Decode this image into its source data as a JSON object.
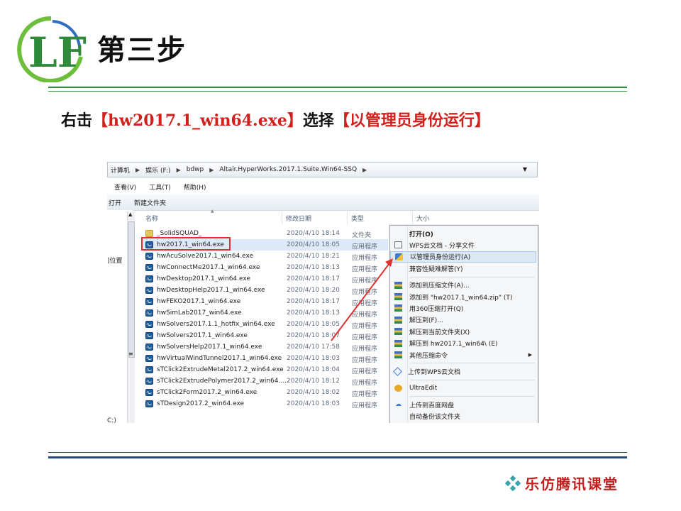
{
  "slide": {
    "title": "第三步",
    "logo_text": "LF",
    "instruction": {
      "prefix": "右击",
      "target": "【hw2017.1_win64.exe】",
      "middle": "选择",
      "action": "【以管理员身份运行】"
    },
    "brand": "乐仿腾讯课堂",
    "colors": {
      "accent_green": "#2f8a3a",
      "accent_red": "#d0211d",
      "footer_blue": "#2a4a85"
    }
  },
  "explorer": {
    "address": [
      "计算机",
      "娱乐 (F:)",
      "bdwp",
      "Altair.HyperWorks.2017.1.Suite.Win64-SSQ"
    ],
    "menu": [
      "查看(V)",
      "工具(T)",
      "帮助(H)"
    ],
    "toolbar": [
      "打开",
      "新建文件夹"
    ],
    "left_pane": {
      "location": "]位置",
      "drive": "C:)"
    },
    "columns": {
      "name": "名称",
      "date": "修改日期",
      "type": "类型",
      "size": "大小"
    },
    "files": [
      {
        "name": "_SolidSQUAD_",
        "date": "2020/4/10 18:14",
        "type": "文件夹",
        "icon": "folder-icon"
      },
      {
        "name": "hw2017.1_win64.exe",
        "date": "2020/4/10 18:05",
        "type": "应用程序",
        "icon": "exe-icon",
        "selected": true
      },
      {
        "name": "hwAcuSolve2017.1_win64.exe",
        "date": "2020/4/10 18:21",
        "type": "应用程序",
        "icon": "exe-icon"
      },
      {
        "name": "hwConnectMe2017.1_win64.exe",
        "date": "2020/4/10 18:13",
        "type": "应用程序",
        "icon": "exe-icon"
      },
      {
        "name": "hwDesktop2017.1_win64.exe",
        "date": "2020/4/10 18:17",
        "type": "应用程序",
        "icon": "exe-icon"
      },
      {
        "name": "hwDesktopHelp2017.1_win64.exe",
        "date": "2020/4/10 18:20",
        "type": "应用程序",
        "icon": "exe-icon"
      },
      {
        "name": "hwFEKO2017.1_win64.exe",
        "date": "2020/4/10 18:17",
        "type": "应用程序",
        "icon": "exe-icon"
      },
      {
        "name": "hwSimLab2017_win64.exe",
        "date": "2020/4/10 18:13",
        "type": "应用程序",
        "icon": "exe-icon"
      },
      {
        "name": "hwSolvers2017.1.1_hotfix_win64.exe",
        "date": "2020/4/10 18:05",
        "type": "应用程序",
        "icon": "exe-icon"
      },
      {
        "name": "hwSolvers2017.1_win64.exe",
        "date": "2020/4/10 18:07",
        "type": "应用程序",
        "icon": "exe-icon"
      },
      {
        "name": "hwSolversHelp2017.1_win64.exe",
        "date": "2020/4/10 17:58",
        "type": "应用程序",
        "icon": "exe-icon"
      },
      {
        "name": "hwVirtualWindTunnel2017.1_win64.exe",
        "date": "2020/4/10 18:03",
        "type": "应用程序",
        "icon": "exe-icon"
      },
      {
        "name": "sTClick2ExtrudeMetal2017.2_win64.exe",
        "date": "2020/4/10 18:04",
        "type": "应用程序",
        "icon": "exe-icon"
      },
      {
        "name": "sTClick2ExtrudePolymer2017.2_win64....",
        "date": "2020/4/10 18:12",
        "type": "应用程序",
        "icon": "exe-icon"
      },
      {
        "name": "sTClick2Form2017.2_win64.exe",
        "date": "2020/4/10 18:02",
        "type": "应用程序",
        "icon": "exe-icon"
      },
      {
        "name": "sTDesign2017.2_win64.exe",
        "date": "2020/4/10 18:03",
        "type": "应用程序",
        "icon": "exe-icon"
      }
    ],
    "context_menu": [
      {
        "label": "打开(O)",
        "icon": "blank",
        "bold": true
      },
      {
        "label": "WPS云文档 - 分享文件",
        "icon": "share-icon"
      },
      {
        "label": "以管理员身份运行(A)",
        "icon": "shield-icon",
        "hover": true
      },
      {
        "label": "兼容性疑难解答(Y)",
        "icon": "blank"
      },
      {
        "sep": true
      },
      {
        "label": "添加到压缩文件(A)...",
        "icon": "zip-icon"
      },
      {
        "label": "添加到 \"hw2017.1_win64.zip\" (T)",
        "icon": "zip-icon"
      },
      {
        "label": "用360压缩打开(Q)",
        "icon": "zip-icon"
      },
      {
        "label": "解压到(F)...",
        "icon": "zip-icon"
      },
      {
        "label": "解压到当前文件夹(X)",
        "icon": "zip-icon"
      },
      {
        "label": "解压到 hw2017.1_win64\\ (E)",
        "icon": "zip-icon"
      },
      {
        "label": "其他压缩命令",
        "icon": "zip-icon",
        "submenu": true
      },
      {
        "sep": true
      },
      {
        "label": "上传到WPS云文档",
        "icon": "wps-icon"
      },
      {
        "sep": true
      },
      {
        "label": "UltraEdit",
        "icon": "ultraedit-icon"
      },
      {
        "sep": true
      },
      {
        "label": "上传到百度网盘",
        "icon": "baidu-icon"
      },
      {
        "label": "自动备份该文件夹",
        "icon": "blank"
      }
    ]
  }
}
